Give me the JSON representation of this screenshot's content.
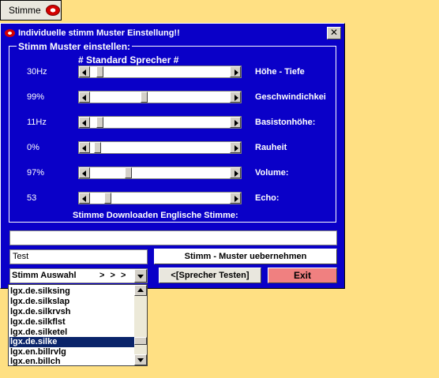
{
  "taskbar": {
    "label": "Stimme",
    "icon": "lips-icon"
  },
  "window": {
    "title": "Individuelle stimm Muster Einstellung!!",
    "close": "✕",
    "group_legend": "Stimm Muster einstellen:",
    "standard_title": "# Standard Sprecher #",
    "sliders": [
      {
        "value": "30Hz",
        "label": "Höhe - Tiefe",
        "level": 0.05
      },
      {
        "value": "99%",
        "label": "Geschwindichkeit:",
        "level": 0.38
      },
      {
        "value": "11Hz",
        "label": "Basistonhöhe:",
        "level": 0.05
      },
      {
        "value": "0%",
        "label": "Rauheit",
        "level": 0.03
      },
      {
        "value": "97%",
        "label": "Volume:",
        "level": 0.26
      },
      {
        "value": "53",
        "label": "Echo:",
        "level": 0.11
      }
    ],
    "download_title": "Stimme Downloaden Englische Stimme:",
    "long_field_value": "",
    "name_field_value": "Test",
    "buttons": {
      "muster": "Stimm -  Muster uebernehmen",
      "test": "<[Sprecher Testen]",
      "exit": "Exit"
    },
    "combo": {
      "label": "Stimm Auswahl",
      "arrows": "> > >"
    }
  },
  "list": {
    "items": [
      "lgx.de.silksing",
      "lgx.de.silkslap",
      "lgx.de.silkrvsh",
      "lgx.de.silkflst",
      "lgx.de.silketel",
      "lgx.de.silke",
      "lgx.en.billrvlg",
      "lgx.en.billch"
    ],
    "selected_index": 5
  },
  "colors": {
    "window_bg": "#0A00C8",
    "desktop_bg": "#FFE083",
    "exit_bg": "#F08080"
  }
}
